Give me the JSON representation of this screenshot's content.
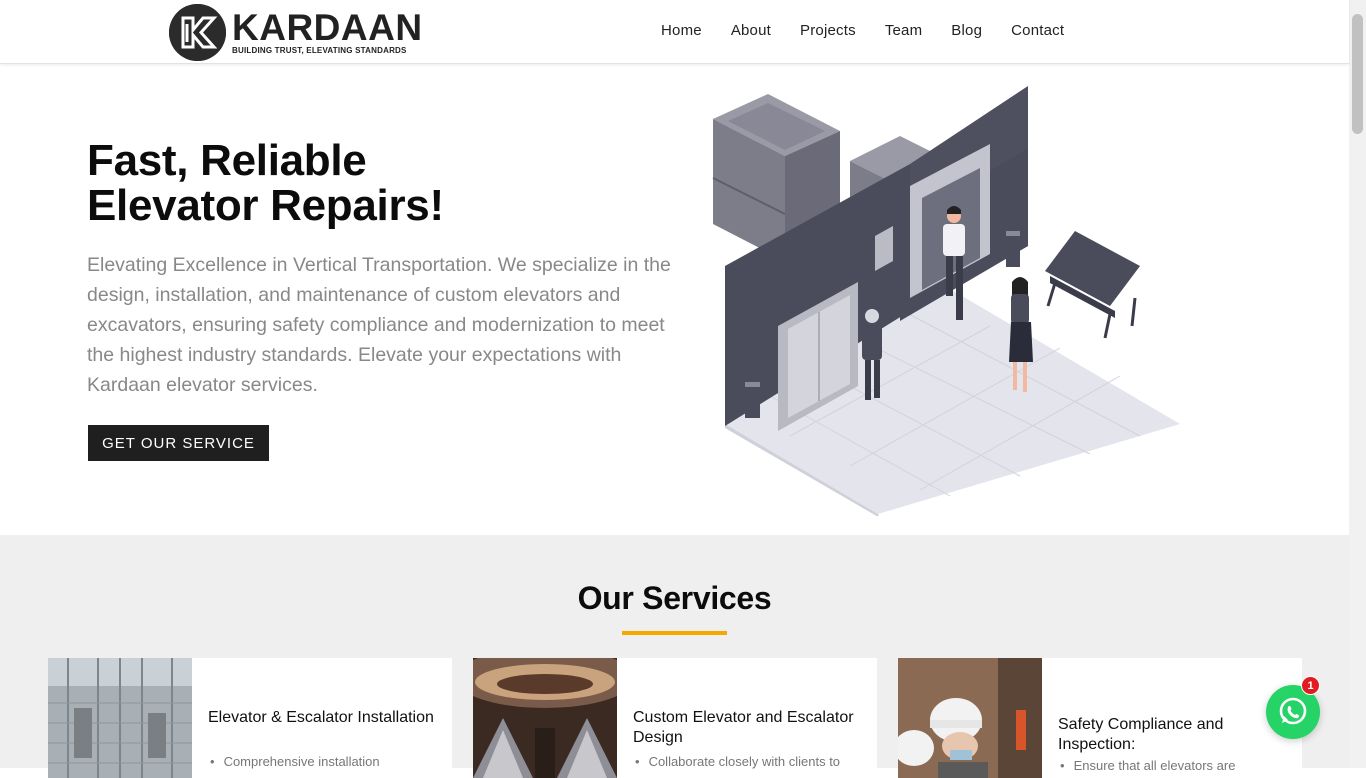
{
  "brand": {
    "name": "KARDAAN",
    "tagline": "BUILDING TRUST, ELEVATING STANDARDS",
    "colors": {
      "accent": "#f5a800",
      "dark": "#1f1f1f",
      "whatsapp": "#25d366"
    }
  },
  "nav": {
    "items": [
      {
        "label": "Home"
      },
      {
        "label": "About"
      },
      {
        "label": "Projects"
      },
      {
        "label": "Team"
      },
      {
        "label": "Blog"
      },
      {
        "label": "Contact"
      }
    ]
  },
  "hero": {
    "title_line1": "Fast, Reliable",
    "title_line2": "Elevator Repairs!",
    "description": "Elevating Excellence in Vertical Transportation. We specialize in the design, installation, and maintenance of custom elevators and excavators, ensuring safety compliance and modernization to meet the highest industry standards. Elevate your expectations with Kardaan elevator services.",
    "cta_label": "GET OUR SERVICE"
  },
  "services": {
    "heading": "Our Services",
    "cards": [
      {
        "title": "Elevator & Escalator Installation",
        "bullet": "Comprehensive installation"
      },
      {
        "title": "Custom Elevator and Escalator Design",
        "bullet": "Collaborate closely with clients to"
      },
      {
        "title": "Safety Compliance and Inspection:",
        "bullet": "Ensure that all elevators are"
      }
    ]
  },
  "whatsapp": {
    "icon": "whatsapp-icon",
    "badge_count": "1"
  }
}
